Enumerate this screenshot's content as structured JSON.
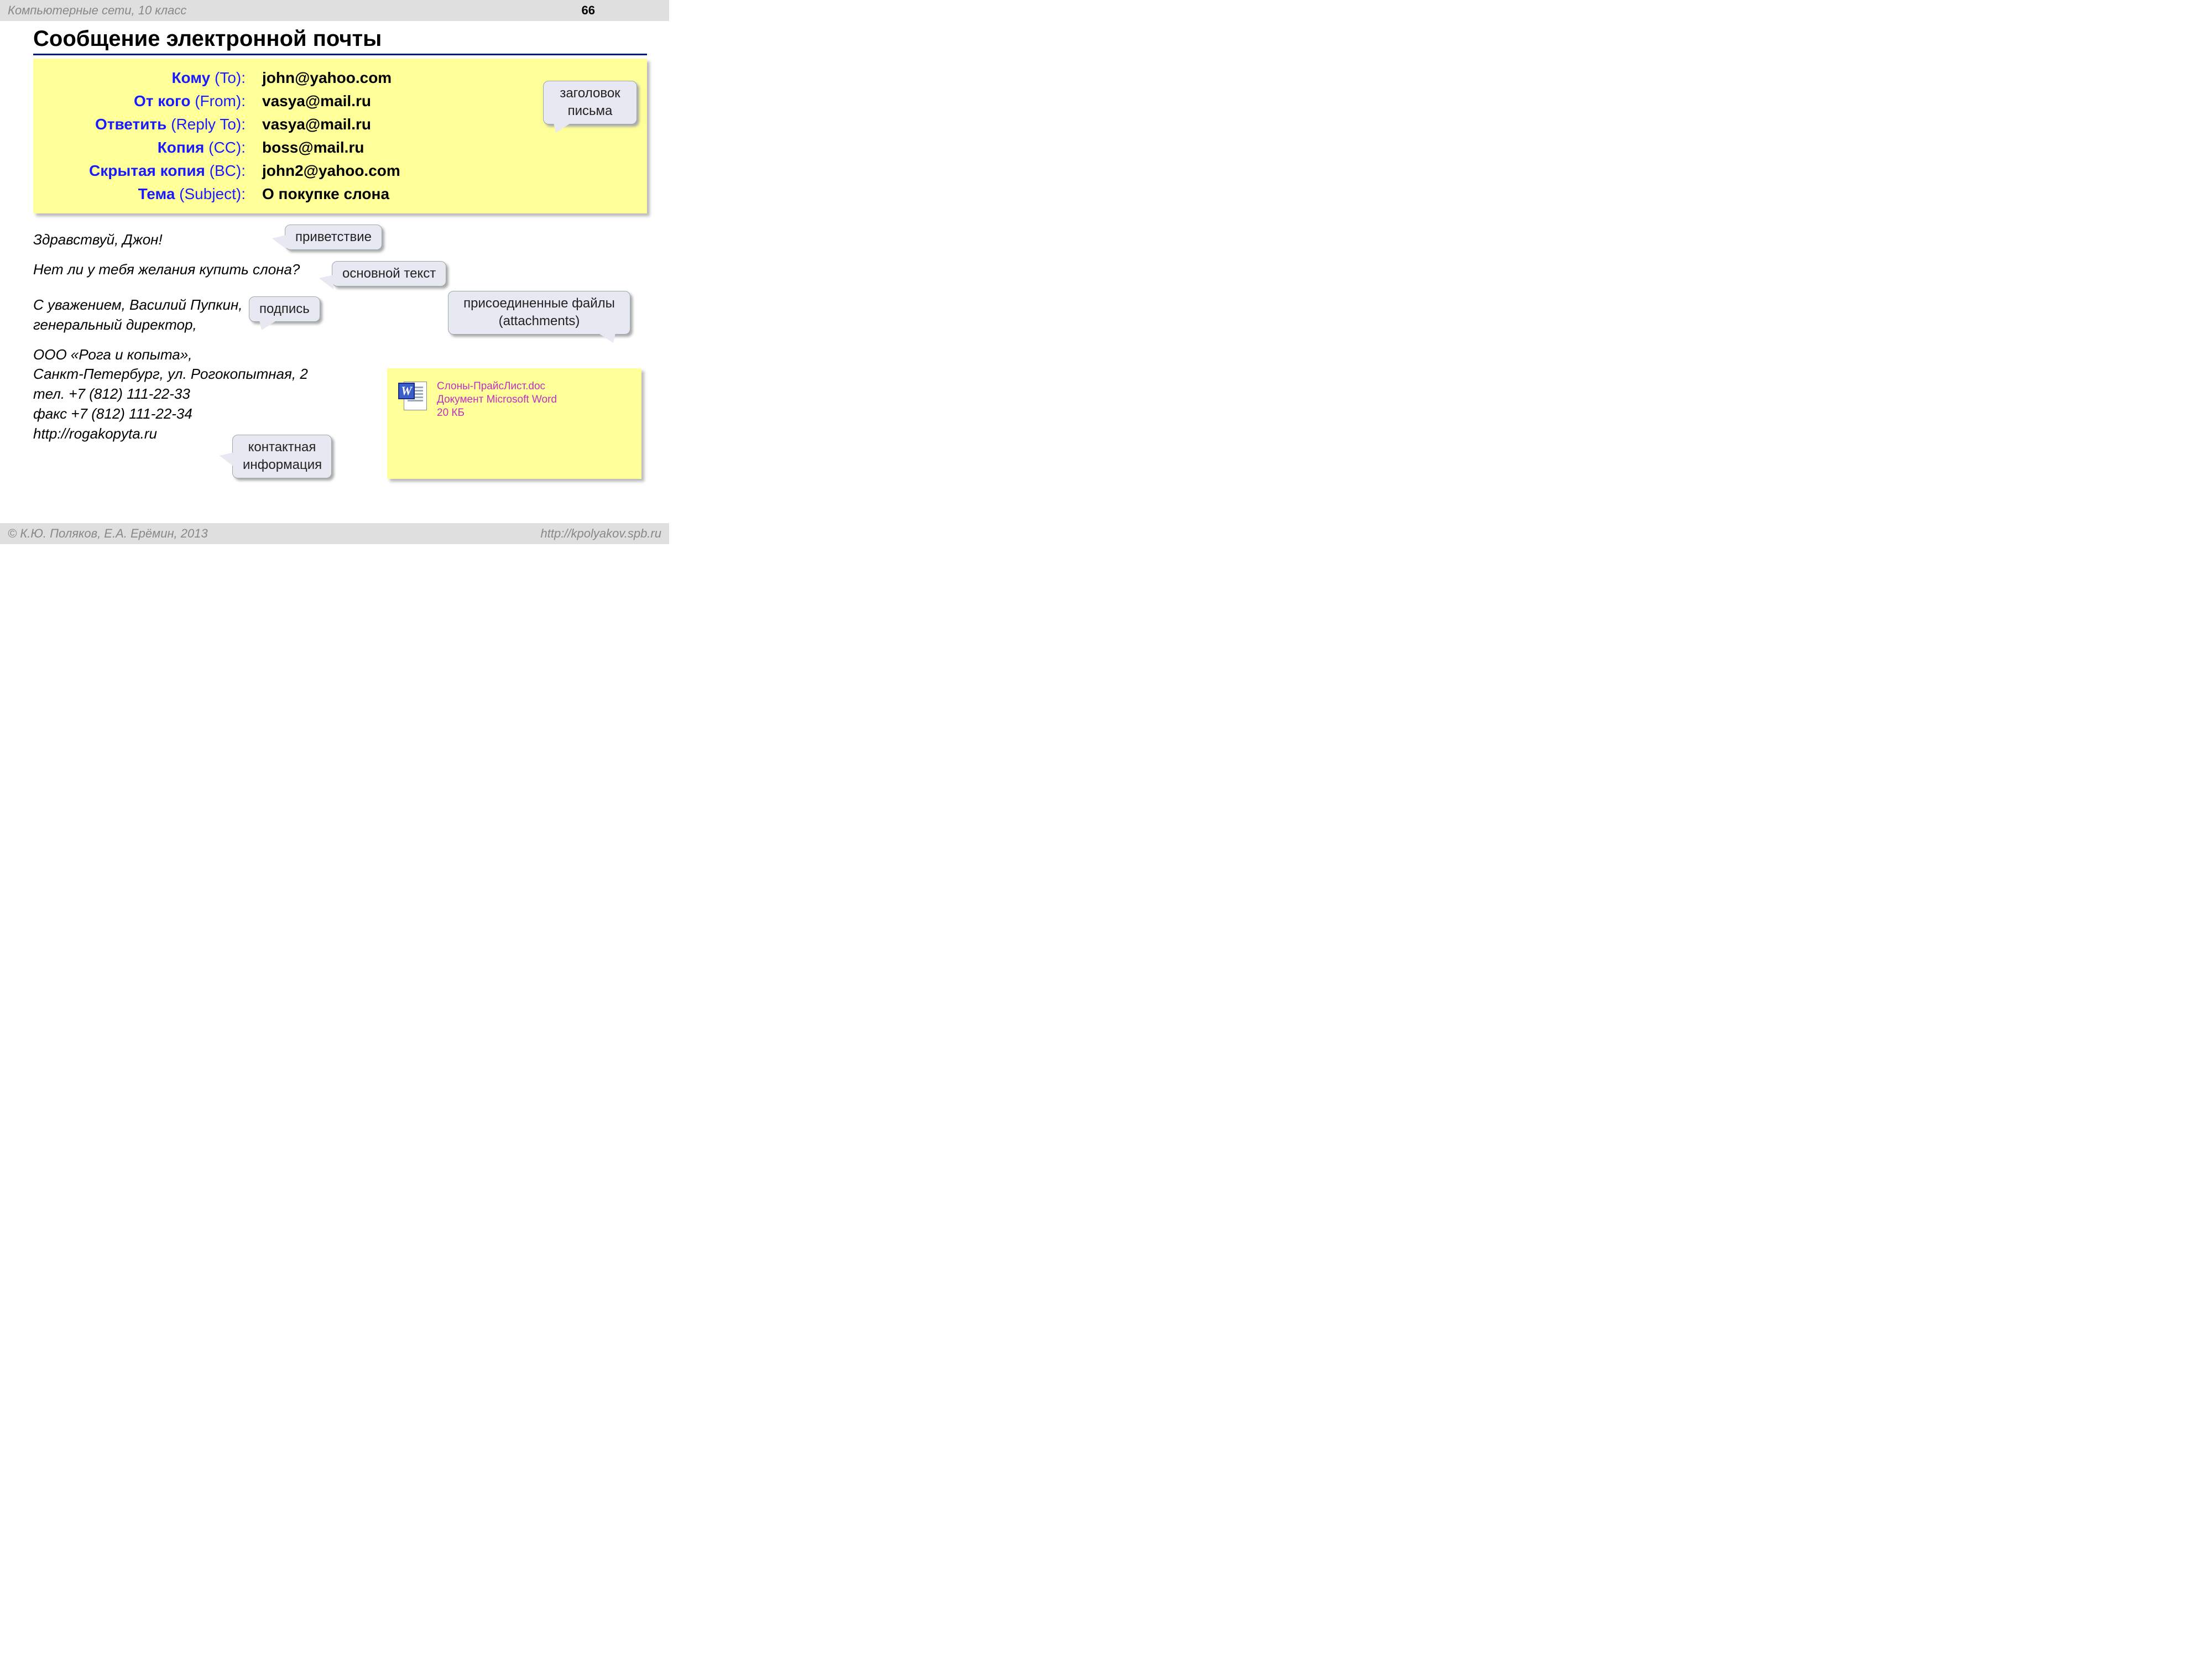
{
  "top": {
    "course": "Компьютерные сети, 10 класс",
    "page": "66"
  },
  "title": "Сообщение электронной почты",
  "header": {
    "rows": [
      {
        "ru": "Кому",
        "en": "(To):",
        "value": "john@yahoo.com"
      },
      {
        "ru": "От кого",
        "en": "(From):",
        "value": "vasya@mail.ru"
      },
      {
        "ru": "Ответить",
        "en": "(Reply To):",
        "value": "vasya@mail.ru"
      },
      {
        "ru": "Копия",
        "en": "(CC):",
        "value": "boss@mail.ru"
      },
      {
        "ru": "Скрытая копия",
        "en": "(BC):",
        "value": "john2@yahoo.com"
      },
      {
        "ru": "Тема",
        "en": "(Subject):",
        "value": "О покупке слона"
      }
    ]
  },
  "callouts": {
    "header": "заголовок\nписьма",
    "greeting": "приветствие",
    "body": "основной текст",
    "signature": "подпись",
    "contact": "контактная\nинформация",
    "attachments": "присоединенные файлы\n(attachments)"
  },
  "body": {
    "greeting": "Здравствуй, Джон!",
    "main": "Нет ли у тебя желания купить слона?",
    "signature": "С уважением, Василий Пупкин,\nгенеральный директор,",
    "contact": "ООО «Рога и копыта»,\nСанкт-Петербург, ул. Рогокопытная, 2\nтел. +7 (812) 111-22-33\nфакс +7 (812) 111-22-34\nhttp://rogakopyta.ru"
  },
  "attachment": {
    "filename": "Слоны-ПрайсЛист.doc",
    "filetype": "Документ Microsoft Word",
    "filesize": "20 КБ"
  },
  "footer": {
    "copyright": "© К.Ю. Поляков, Е.А. Ерёмин, 2013",
    "url": "http://kpolyakov.spb.ru"
  }
}
